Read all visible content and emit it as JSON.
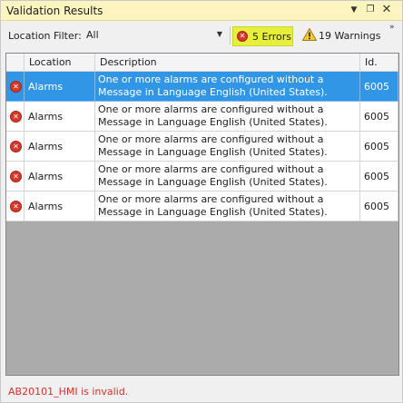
{
  "window": {
    "title": "Validation Results",
    "dropdown_glyph": "▼",
    "restore_glyph": "❐",
    "close_glyph": "✕"
  },
  "toolbar": {
    "filter_label": "Location Filter:",
    "filter_value": "All",
    "errors_label": "5 Errors",
    "warnings_label": "19 Warnings",
    "overflow_glyph": "»",
    "errors_highlight_color": "#e8ef3a"
  },
  "grid": {
    "columns": [
      "",
      "Location",
      "Description",
      "Id."
    ],
    "rows": [
      {
        "location": "Alarms",
        "description": "One or more alarms are configured without a Message in Language English (United States).",
        "id": "6005",
        "selected": true
      },
      {
        "location": "Alarms",
        "description": "One or more alarms are configured without a Message in Language English (United States).",
        "id": "6005",
        "selected": false
      },
      {
        "location": "Alarms",
        "description": "One or more alarms are configured without a Message in Language English (United States).",
        "id": "6005",
        "selected": false
      },
      {
        "location": "Alarms",
        "description": "One or more alarms are configured without a Message in Language English (United States).",
        "id": "6005",
        "selected": false
      },
      {
        "location": "Alarms",
        "description": "One or more alarms are configured without a Message in Language English (United States).",
        "id": "6005",
        "selected": false
      }
    ]
  },
  "status": {
    "message": "AB20101_HMI is invalid.",
    "color": "#d4302a"
  }
}
